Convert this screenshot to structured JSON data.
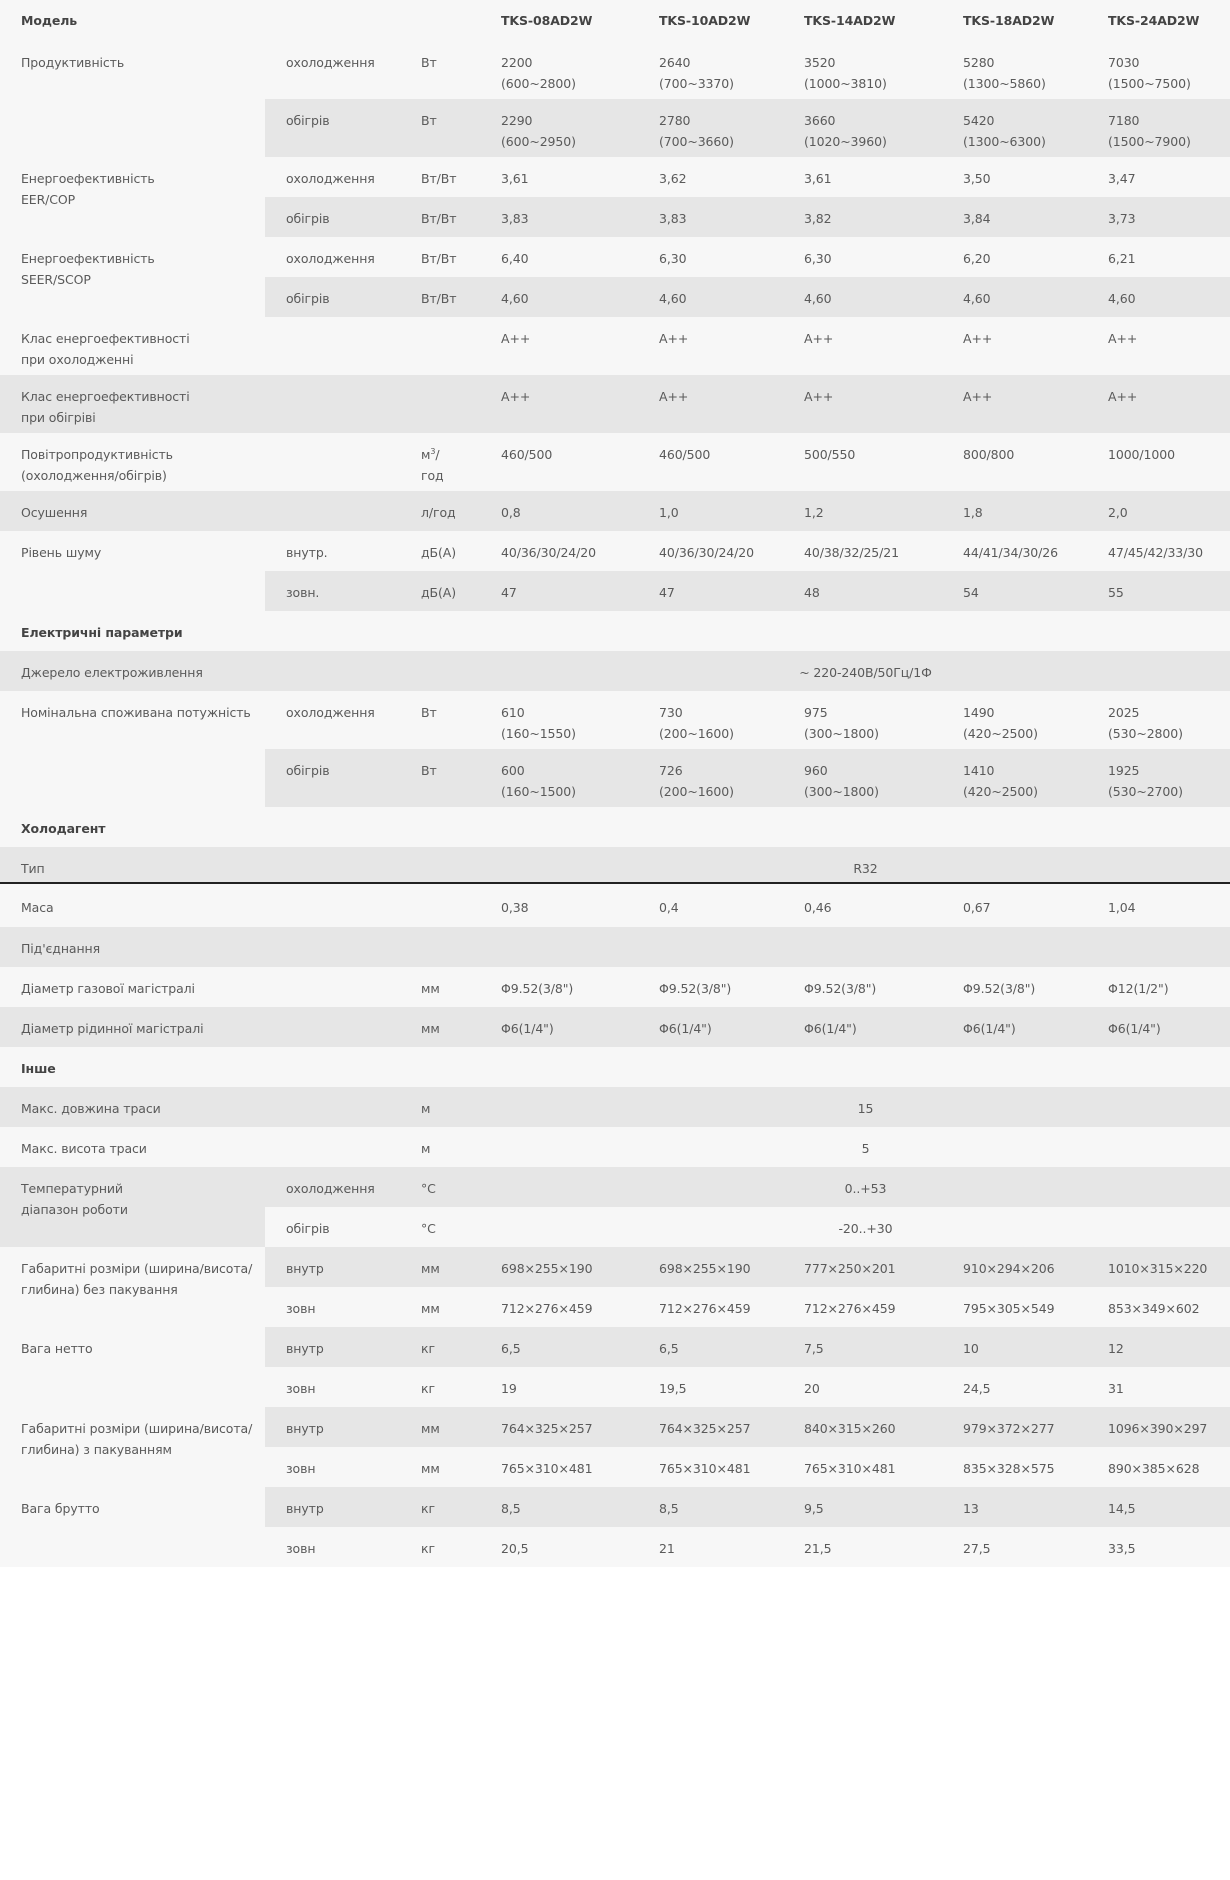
{
  "header": {
    "model_label": "Модель",
    "models": [
      "TKS-08AD2W",
      "TKS-10AD2W",
      "TKS-14AD2W",
      "TKS-18AD2W",
      "TKS-24AD2W"
    ]
  },
  "rows": {
    "capacity": {
      "label": "Продуктивність",
      "cool": {
        "mode": "охолодження",
        "unit": "Вт",
        "values": [
          "2200\n(600~2800)",
          "2640\n(700~3370)",
          "3520\n(1000~3810)",
          "5280\n(1300~5860)",
          "7030\n(1500~7500)"
        ]
      },
      "heat": {
        "mode": "обігрів",
        "unit": "Вт",
        "values": [
          "2290\n(600~2950)",
          "2780\n(700~3660)",
          "3660\n(1020~3960)",
          "5420\n(1300~6300)",
          "7180\n(1500~7900)"
        ]
      }
    },
    "eer": {
      "label": "Енергоефективність\nEER/COP",
      "cool": {
        "mode": "охолодження",
        "unit": "Вт/Вт",
        "values": [
          "3,61",
          "3,62",
          "3,61",
          "3,50",
          "3,47"
        ]
      },
      "heat": {
        "mode": "обігрів",
        "unit": "Вт/Вт",
        "values": [
          "3,83",
          "3,83",
          "3,82",
          "3,84",
          "3,73"
        ]
      }
    },
    "seer": {
      "label": "Енергоефективність\nSEER/SCOP",
      "cool": {
        "mode": "охолодження",
        "unit": "Вт/Вт",
        "values": [
          "6,40",
          "6,30",
          "6,30",
          "6,20",
          "6,21"
        ]
      },
      "heat": {
        "mode": "обігрів",
        "unit": "Вт/Вт",
        "values": [
          "4,60",
          "4,60",
          "4,60",
          "4,60",
          "4,60"
        ]
      }
    },
    "class_cool": {
      "label": "Клас енергоефективності\nпри охолодженні",
      "values": [
        "A++",
        "A++",
        "A++",
        "A++",
        "A++"
      ]
    },
    "class_heat": {
      "label": "Клас енергоефективності\nпри обігріві",
      "values": [
        "A++",
        "A++",
        "A++",
        "A++",
        "A++"
      ]
    },
    "airflow": {
      "label": "Повітропродуктивність\n(охолодження/обігрів)",
      "unit_base": "м",
      "unit_sup": "3",
      "unit_tail": "/\nгод",
      "values": [
        "460/500",
        "460/500",
        "500/550",
        "800/800",
        "1000/1000"
      ]
    },
    "dehum": {
      "label": "Осушення",
      "unit": "л/год",
      "values": [
        "0,8",
        "1,0",
        "1,2",
        "1,8",
        "2,0"
      ]
    },
    "noise": {
      "label": "Рівень шуму",
      "inner": {
        "mode": "внутр.",
        "unit": "дБ(А)",
        "values": [
          "40/36/30/24/20",
          "40/36/30/24/20",
          "40/38/32/25/21",
          "44/41/34/30/26",
          "47/45/42/33/30"
        ]
      },
      "outer": {
        "mode": "зовн.",
        "unit": "дБ(А)",
        "values": [
          "47",
          "47",
          "48",
          "54",
          "55"
        ]
      }
    },
    "electrical_heading": "Електричні параметри",
    "power_source": {
      "label": "Джерело електроживлення",
      "value": "~ 220-240В/50Гц/1Ф"
    },
    "power": {
      "label": "Номінальна споживана потужність",
      "cool": {
        "mode": "охолодження",
        "unit": "Вт",
        "values": [
          "610\n(160~1550)",
          "730\n(200~1600)",
          "975\n(300~1800)",
          "1490\n(420~2500)",
          "2025\n(530~2800)"
        ]
      },
      "heat": {
        "mode": "обігрів",
        "unit": "Вт",
        "values": [
          "600\n(160~1500)",
          "726\n(200~1600)",
          "960\n(300~1800)",
          "1410\n(420~2500)",
          "1925\n(530~2700)"
        ]
      }
    },
    "refrigerant_heading": "Холодагент",
    "ref_type": {
      "label": "Тип",
      "value": "R32"
    },
    "mass": {
      "label": "Маса",
      "values": [
        "0,38",
        "0,4",
        "0,46",
        "0,67",
        "1,04"
      ]
    },
    "connection": {
      "label": "Під'єднання"
    },
    "gas_pipe": {
      "label": "Діаметр газової магістралі",
      "unit": "мм",
      "values": [
        "Φ9.52(3/8\")",
        "Φ9.52(3/8\")",
        "Φ9.52(3/8\")",
        "Φ9.52(3/8\")",
        "Φ12(1/2\")"
      ]
    },
    "liquid_pipe": {
      "label": "Діаметр рідинної магістралі",
      "unit": "мм",
      "values": [
        "Φ6(1/4\")",
        "Φ6(1/4\")",
        "Φ6(1/4\")",
        "Φ6(1/4\")",
        "Φ6(1/4\")"
      ]
    },
    "other_heading": "Інше",
    "max_length": {
      "label": "Макс. довжина траси",
      "unit": "м",
      "value": "15"
    },
    "max_height": {
      "label": "Макс. висота траси",
      "unit": "м",
      "value": "5"
    },
    "temp_range": {
      "label": "Температурний\nдіапазон роботи",
      "cool": {
        "mode": "охолодження",
        "unit": "°C",
        "value": "0..+53"
      },
      "heat": {
        "mode": "обігрів",
        "unit": "°C",
        "value": "-20..+30"
      }
    },
    "dims_unpacked": {
      "label": "Габаритні розміри (ширина/висота/\nглибина) без пакування",
      "inner": {
        "mode": "внутр",
        "unit": "мм",
        "values": [
          "698×255×190",
          "698×255×190",
          "777×250×201",
          "910×294×206",
          "1010×315×220"
        ]
      },
      "outer": {
        "mode": "зовн",
        "unit": "мм",
        "values": [
          "712×276×459",
          "712×276×459",
          "712×276×459",
          "795×305×549",
          "853×349×602"
        ]
      }
    },
    "net_weight": {
      "label": "Вага нетто",
      "inner": {
        "mode": "внутр",
        "unit": "кг",
        "values": [
          "6,5",
          "6,5",
          "7,5",
          "10",
          "12"
        ]
      },
      "outer": {
        "mode": "зовн",
        "unit": "кг",
        "values": [
          "19",
          "19,5",
          "20",
          "24,5",
          "31"
        ]
      }
    },
    "dims_packed": {
      "label": "Габаритні розміри (ширина/висота/\nглибина) з пакуванням",
      "inner": {
        "mode": "внутр",
        "unit": "мм",
        "values": [
          "764×325×257",
          "764×325×257",
          "840×315×260",
          "979×372×277",
          "1096×390×297"
        ]
      },
      "outer": {
        "mode": "зовн",
        "unit": "мм",
        "values": [
          "765×310×481",
          "765×310×481",
          "765×310×481",
          "835×328×575",
          "890×385×628"
        ]
      }
    },
    "gross_weight": {
      "label": "Вага брутто",
      "inner": {
        "mode": "внутр",
        "unit": "кг",
        "values": [
          "8,5",
          "8,5",
          "9,5",
          "13",
          "14,5"
        ]
      },
      "outer": {
        "mode": "зовн",
        "unit": "кг",
        "values": [
          "20,5",
          "21",
          "21,5",
          "27,5",
          "33,5"
        ]
      }
    }
  }
}
